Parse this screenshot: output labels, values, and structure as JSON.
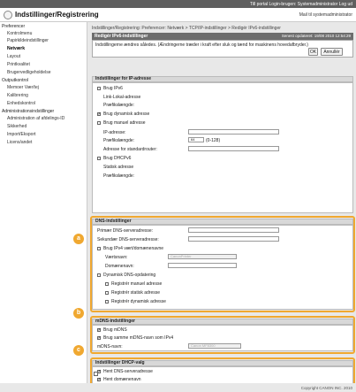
{
  "topbar": {
    "text": "Till portal  Login-brugen: Systemadministrator Log ud"
  },
  "header": {
    "title": "Indstillinger/Registrering",
    "mail_admin": "Mail til systemadministrator"
  },
  "sidebar": {
    "preferences_heading": "Preferencer",
    "preferences": [
      "Kontrolmenu",
      "Papirkildeindstillinger",
      "Netværk",
      "Layout",
      "Printkvalitet",
      "Brugervedligeholdelse"
    ],
    "output_heading": "Outputkontrol",
    "output": [
      "Memoer Vær/tej",
      "Kalibrering",
      "Enhedskontrol"
    ],
    "admin_heading": "Administrationsindstillinger",
    "admin": [
      "Administration af afdelings-ID",
      "Sikkerhed",
      "Import/Eksport",
      "Licens/andet"
    ]
  },
  "breadcrumb": "Indstillinger/Registrering: Preferencer: Netværk > TCP/IP-indstillinger > Redigér IPv6-indstillinger",
  "page": {
    "title": "Redigér IPv6-indstillinger",
    "last_updated": "Senest opdateret: 19/08 2010 12:54:29"
  },
  "notice": "Indstillingerne ændres således. (Ændringerne træder i kraft efter sluk og tænd for maskinens hovedafbryder.)",
  "buttons": {
    "ok": "OK",
    "cancel": "Annullér"
  },
  "ip": {
    "heading": "Indstillinger for IP-adresse",
    "use_ipv6": "Brug IPv6",
    "link_local": "Link-Lokal-adresse",
    "prefix_length": "Præfikslængde:",
    "stateless": "Brug dynamisk adresse",
    "manual": "Brug manuel adresse",
    "ip_address": "IP-adresse:",
    "prefix_length2": "Præfikslængde:",
    "prefix_value": "64",
    "prefix_range": "(0-128)",
    "default_router": "Adresse for standardrouter:",
    "dhcpv6": "Brug DHCPv6",
    "stateful": "Statisk adresse",
    "prefix_length3": "Præfikslængde:"
  },
  "dns": {
    "heading": "DNS-indstillinger",
    "primary": "Primær DNS-serveradresse:",
    "secondary": "Sekundær DNS-serveradresse:",
    "same_as_ipv4": "Brug IPv4 vært/domænenavne",
    "host_name": "Værtsnavn:",
    "host_value": "CanonPrinter",
    "domain_name": "Domænenavn:",
    "dynamic_update": "Dynamisk DNS-opdatering",
    "reg_manual": "Registrér manuel adresse",
    "reg_stateful": "Registrér statisk adresse",
    "reg_stateless": "Registrér dynamisk adresse"
  },
  "mdns": {
    "heading": "mDNS-indstillinger",
    "use_mdns": "Brug mDNS",
    "same_name": "Brug samme mDNS-navn som IPv4",
    "mdns_name": "mDNS-navn:",
    "mdns_value": "Canon MF8300"
  },
  "dhcp": {
    "heading": "Indstillinger DHCP-valg",
    "acquire_dns": "Hent DNS-serveradresse",
    "acquire_domain": "Hent domænenavn"
  },
  "badges": {
    "a": "a",
    "b": "b",
    "c": "c"
  },
  "footer": "Copyright CANON INC. 2010",
  "colors": {
    "accent": "#f0a830",
    "topbar": "#5f5f5f"
  }
}
